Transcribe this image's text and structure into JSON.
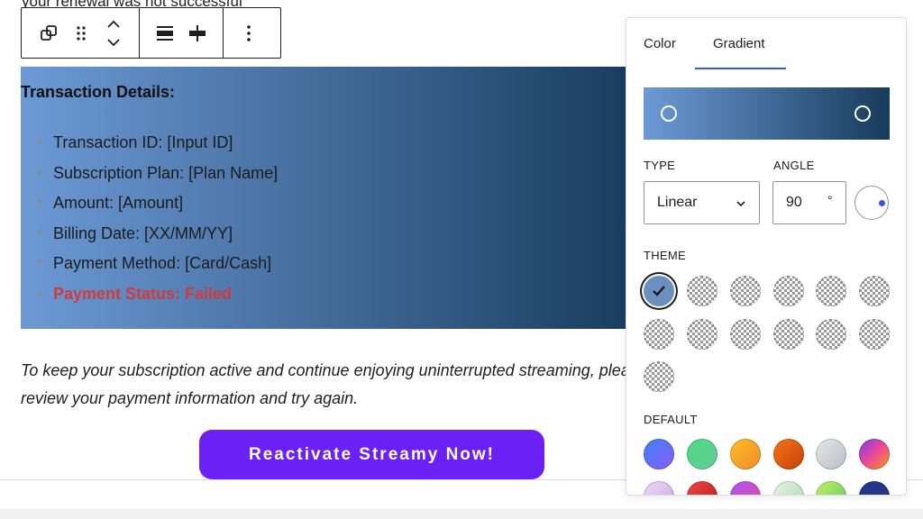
{
  "page": {
    "top_cut_text": "your renewal was not successful",
    "block_title": "Transaction Details:",
    "details": [
      "Transaction ID: [Input ID]",
      "Subscription Plan: [Plan Name]",
      "Amount: [Amount]",
      "Billing Date: [XX/MM/YY]",
      "Payment Method: [Card/Cash]",
      "Payment Status: Failed"
    ],
    "paragraph_line1": "To keep your subscription active and continue enjoying uninterrupted streaming, please",
    "paragraph_line2": "review your payment information and try again.",
    "cta_label": "Reactivate Streamy Now!"
  },
  "toolbar": {
    "icons": [
      "duplicate-icon",
      "drag-handle-icon",
      "move-up-down-icon",
      "align-icon",
      "width-icon",
      "more-options-icon"
    ]
  },
  "popover": {
    "tabs": [
      "Color",
      "Gradient"
    ],
    "active_tab": "Gradient",
    "type_label": "TYPE",
    "type_value": "Linear",
    "angle_label": "ANGLE",
    "angle_value": "90",
    "angle_unit": "°",
    "theme_label": "THEME",
    "default_label": "DEFAULT",
    "gradient_start": "#6d9ad6",
    "gradient_end": "#173b5c"
  },
  "colors": {
    "accent": "#3858e9",
    "cta": "#6b21f5",
    "failed": "#cf3a3a"
  }
}
